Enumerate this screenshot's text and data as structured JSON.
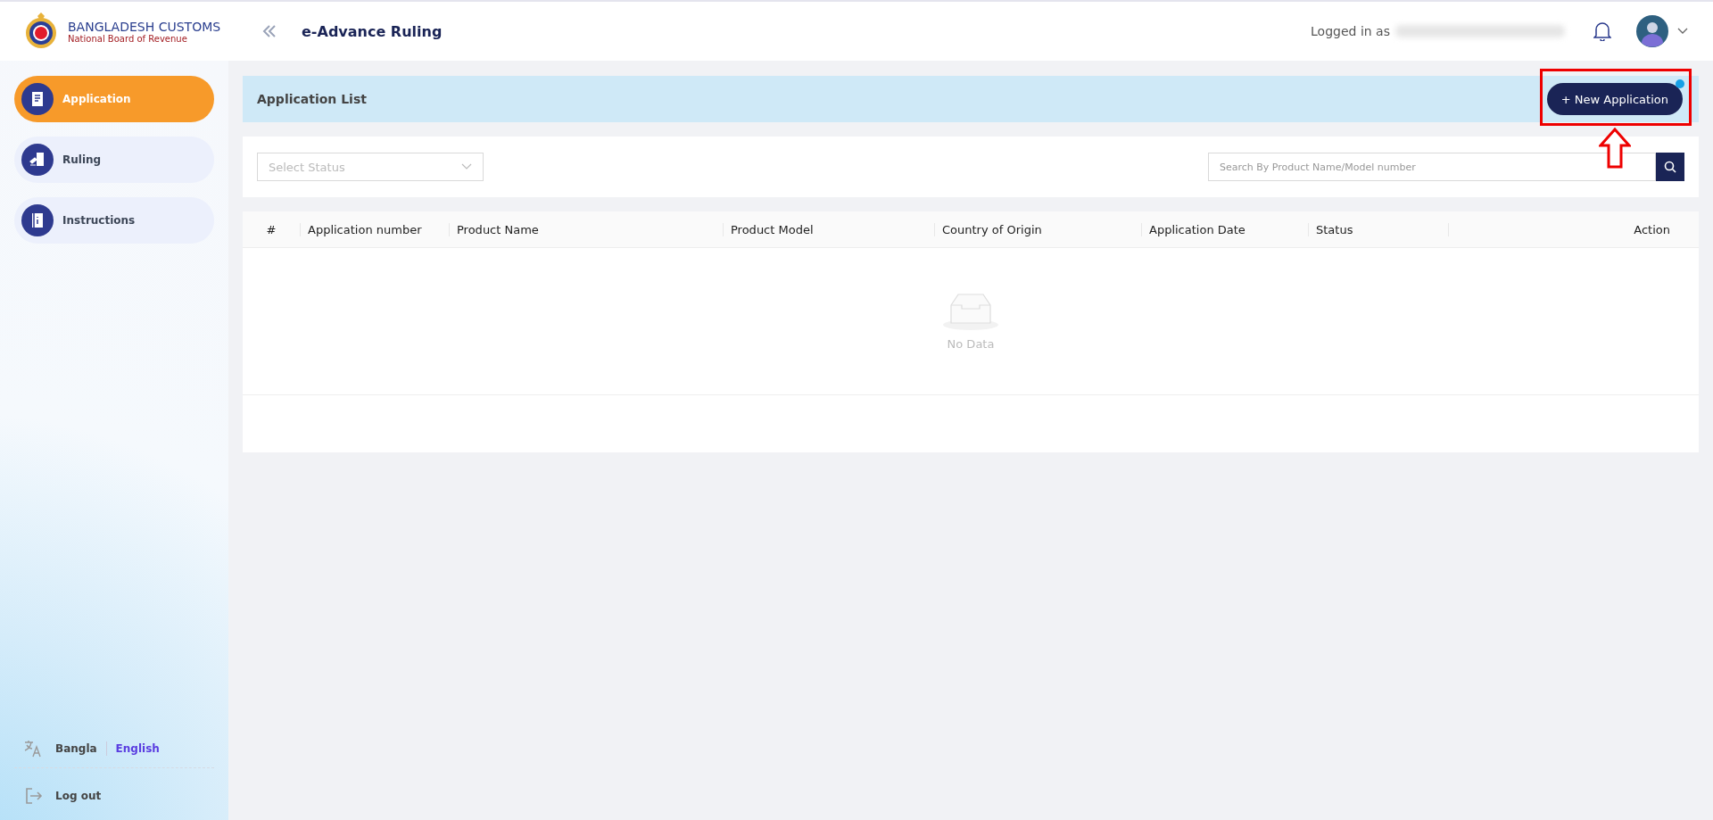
{
  "header": {
    "brand_title": "BANGLADESH CUSTOMS",
    "brand_subtitle": "National Board of Revenue",
    "page_title": "e-Advance Ruling",
    "logged_in_label": "Logged in as"
  },
  "sidebar": {
    "items": [
      {
        "label": "Application",
        "kind": "application",
        "selected": true
      },
      {
        "label": "Ruling",
        "kind": "ruling",
        "selected": false
      },
      {
        "label": "Instructions",
        "kind": "instructions",
        "selected": false
      }
    ],
    "languages": [
      {
        "label": "Bangla",
        "selected": false
      },
      {
        "label": "English",
        "selected": true
      }
    ],
    "logout": "Log out"
  },
  "list_bar": {
    "title": "Application List",
    "new_button": "+ New Application"
  },
  "filters": {
    "status_placeholder": "Select Status",
    "search_placeholder": "Search By Product Name/Model number"
  },
  "table": {
    "columns": [
      "#",
      "Application number",
      "Product Name",
      "Product Model",
      "Country of Origin",
      "Application Date",
      "Status",
      "Action"
    ],
    "empty_text": "No Data"
  }
}
